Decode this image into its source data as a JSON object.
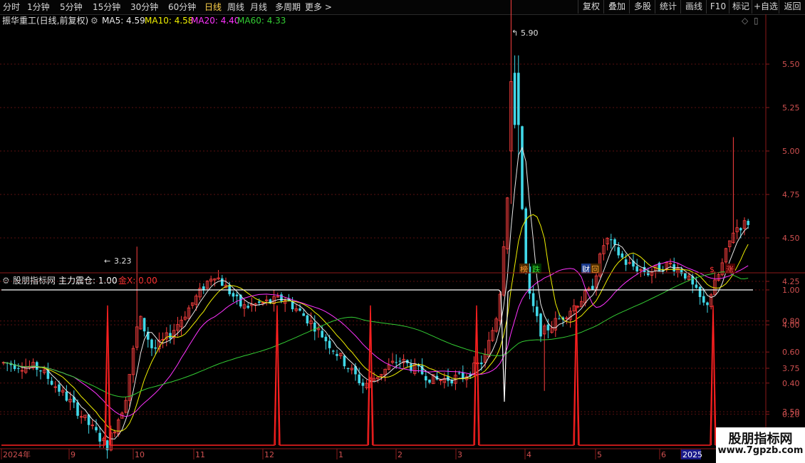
{
  "toolbar": {
    "periods": [
      "分时",
      "1分钟",
      "5分钟",
      "15分钟",
      "30分钟",
      "60分钟",
      "日线",
      "周线",
      "月线",
      "多周期",
      "更多 >"
    ],
    "selected_index": 6,
    "right_buttons": [
      "复权",
      "叠加",
      "多股",
      "统计",
      "画线",
      "F10",
      "标记",
      "+自选",
      "返回"
    ]
  },
  "header": {
    "title": "振华重工(日线,前复权)",
    "ma": [
      {
        "label": "MA5: 4.59",
        "color": "#e8e8e8"
      },
      {
        "label": "MA10: 4.58",
        "color": "#f0f000"
      },
      {
        "label": "MA20: 4.40",
        "color": "#ff33ff"
      },
      {
        "label": "MA60: 4.33",
        "color": "#33cc33"
      }
    ]
  },
  "main_chart": {
    "y_ticks": [
      "5.50",
      "5.25",
      "5.00",
      "4.75",
      "4.50",
      "4.25",
      "4.00",
      "3.75",
      "3.50"
    ],
    "high_label": "5.90",
    "low_label": "3.23",
    "event_markers": [
      {
        "text": "榜",
        "color": "#ff9933",
        "bg": "#4a2a00"
      },
      {
        "text": "跌",
        "color": "#33dd33",
        "bg": "#003300"
      },
      {
        "text": "财",
        "color": "#ffffff",
        "bg": "#1a3a8a"
      },
      {
        "text": "回",
        "color": "#ffaa33",
        "bg": "#4a2a00"
      },
      {
        "text": "$",
        "color": "#ff3333",
        "bg": "transparent"
      },
      {
        "text": "涨",
        "color": "#ff5555",
        "bg": "#4a0000"
      }
    ]
  },
  "indicator": {
    "name": "股朋指标网",
    "line1": "主力震仓: 1.00",
    "line2": "金X: 0.00",
    "line1_color": "#ffffff",
    "line2_color": "#ff3333",
    "y_ticks": [
      "1.00",
      "0.80",
      "0.60",
      "0.40",
      "0.20"
    ]
  },
  "chart_data": {
    "type": "line",
    "series": [
      {
        "name": "主力震仓",
        "values": [
          1.0,
          1.0,
          1.0,
          0.28,
          1.0,
          1.0,
          1.0
        ]
      },
      {
        "name": "金X",
        "values": [
          0.0,
          0.9,
          0.0,
          0.9,
          0.0,
          0.9,
          0.0,
          0.9,
          0.0,
          0.9,
          0.0,
          0.9,
          0.0
        ]
      }
    ],
    "ylim": [
      0,
      1.0
    ]
  },
  "x_axis": {
    "labels": [
      "2024年",
      "9",
      "10",
      "11",
      "12",
      "1",
      "2",
      "3",
      "4",
      "5",
      "6",
      "2025"
    ]
  },
  "watermark": {
    "line1": "股朋指标网",
    "line2": "www.7gpzb.com"
  }
}
